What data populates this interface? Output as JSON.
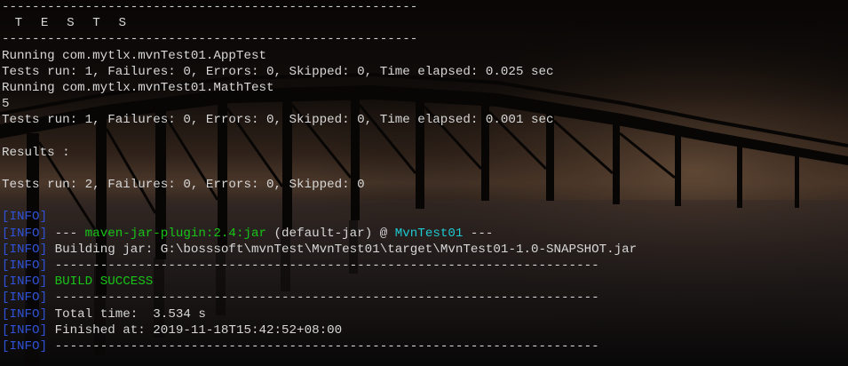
{
  "colors": {
    "text": "#d7d7d7",
    "info": "#2f52d6",
    "success": "#18c418",
    "artifact": "#1ec8d0"
  },
  "icons": {
    "background": "pier-sunset-photo"
  },
  "console": {
    "rule_top": "-------------------------------------------------------",
    "title": " T E S T S",
    "rule_mid": "-------------------------------------------------------",
    "run_app": "Running com.mytlx.mvnTest01.AppTest",
    "result_app": "Tests run: 1, Failures: 0, Errors: 0, Skipped: 0, Time elapsed: 0.025 sec",
    "run_math": "Running com.mytlx.mvnTest01.MathTest",
    "output_5": "5",
    "result_math": "Tests run: 1, Failures: 0, Errors: 0, Skipped: 0, Time elapsed: 0.001 sec",
    "results_label": "Results :",
    "summary": "Tests run: 2, Failures: 0, Errors: 0, Skipped: 0"
  },
  "log": {
    "open_bracket": "[",
    "tag": "INFO",
    "close_bracket": "]",
    "plugin_prefix": " --- ",
    "plugin_name": "maven-jar-plugin:2.4:jar",
    "plugin_middle": " (default-jar) @ ",
    "artifact": "MvnTest01",
    "plugin_suffix": " ---",
    "building_jar": " Building jar: G:\\bosssoft\\mvnTest\\MvnTest01\\target\\MvnTest01-1.0-SNAPSHOT.jar",
    "rule": " ------------------------------------------------------------------------",
    "build_success": " BUILD SUCCESS",
    "total_time": " Total time:  3.534 s",
    "finished_at": " Finished at: 2019-11-18T15:42:52+08:00"
  }
}
